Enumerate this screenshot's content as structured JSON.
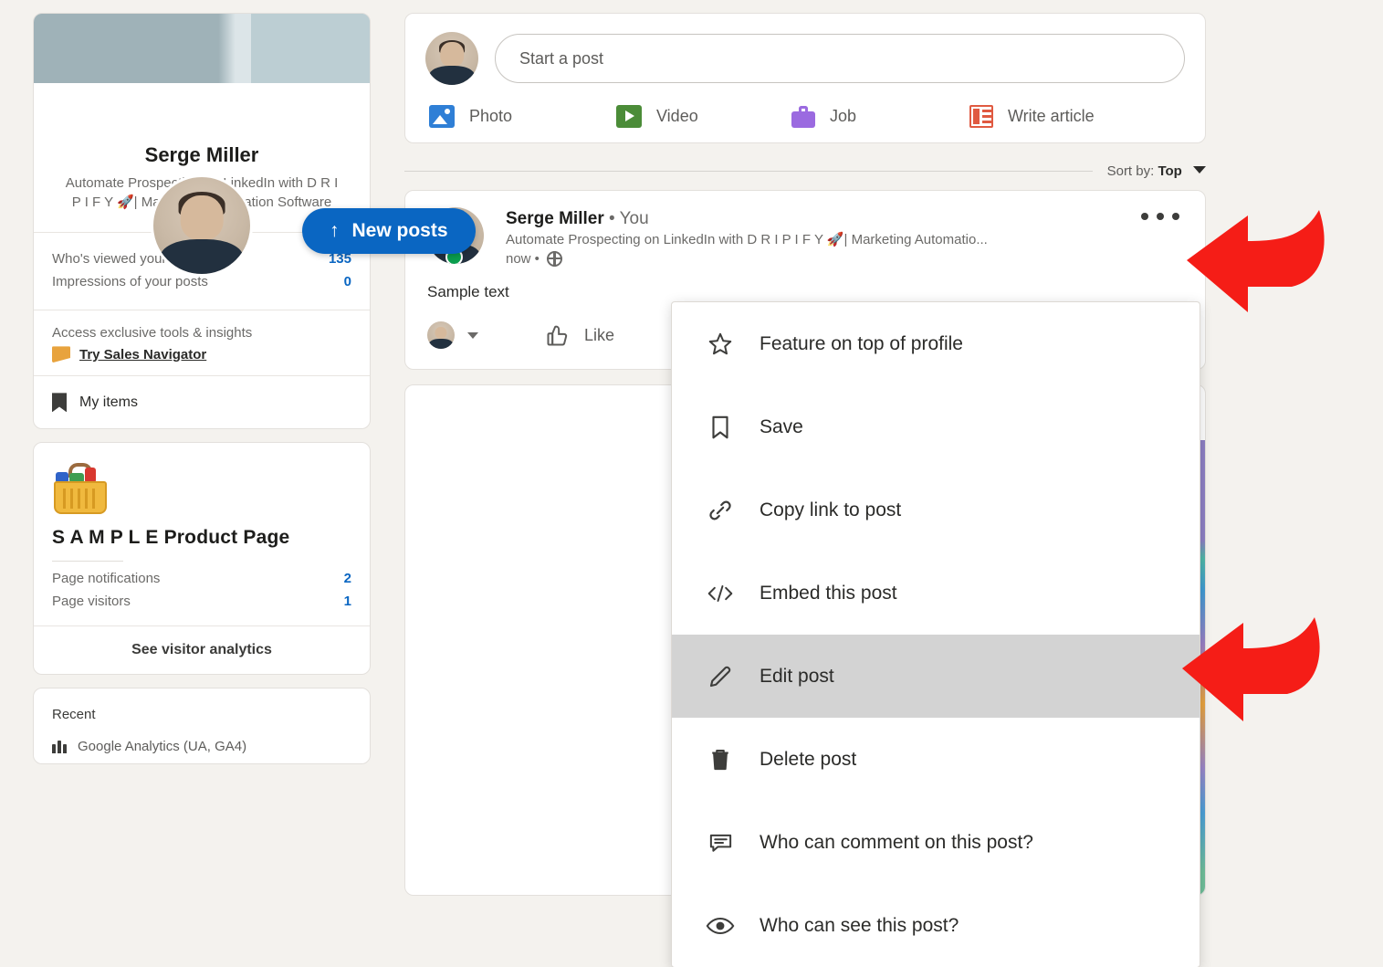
{
  "sidebar": {
    "profile": {
      "name": "Serge Miller",
      "headline": "Automate Prospecting on LinkedIn with D R I P I F Y 🚀| Marketing Automation Software",
      "avatar_icon": "user-avatar"
    },
    "stats": [
      {
        "label": "Who's viewed your profile",
        "value": "135"
      },
      {
        "label": "Impressions of your posts",
        "value": "0"
      }
    ],
    "tools": {
      "label": "Access exclusive tools & insights",
      "link": "Try Sales Navigator",
      "icon": "sales-navigator-icon"
    },
    "my_items": {
      "label": "My items",
      "icon": "bookmark-icon"
    },
    "product_page": {
      "icon": "shopping-basket-icon",
      "title": "S A M P L E Product Page",
      "stats": [
        {
          "label": "Page notifications",
          "value": "2"
        },
        {
          "label": "Page visitors",
          "value": "1"
        }
      ],
      "cta": "See visitor analytics"
    },
    "recent": {
      "title": "Recent",
      "items": [
        {
          "label": "Google Analytics (UA, GA4)",
          "icon": "group-icon"
        }
      ]
    }
  },
  "composer": {
    "placeholder": "Start a post",
    "actions": [
      {
        "label": "Photo",
        "icon": "photo-icon"
      },
      {
        "label": "Video",
        "icon": "video-icon"
      },
      {
        "label": "Job",
        "icon": "job-icon"
      },
      {
        "label": "Write article",
        "icon": "article-icon"
      }
    ]
  },
  "feed": {
    "sort_prefix": "Sort by:",
    "sort_value": "Top",
    "new_posts_label": "New posts",
    "new_posts_arrow": "↑",
    "post": {
      "author": "Serge Miller",
      "author_suffix": "• You",
      "headline": "Automate Prospecting on LinkedIn with D R I P I F Y 🚀| Marketing Automatio...",
      "time": "now •",
      "visibility_icon": "globe-icon",
      "body": "Sample text",
      "like_label": "Like",
      "overflow_icon": "more-options-icon"
    }
  },
  "dropdown": {
    "items": [
      {
        "label": "Feature on top of profile",
        "icon": "star-icon",
        "active": false
      },
      {
        "label": "Save",
        "icon": "bookmark-icon",
        "active": false
      },
      {
        "label": "Copy link to post",
        "icon": "link-icon",
        "active": false
      },
      {
        "label": "Embed this post",
        "icon": "code-icon",
        "active": false
      },
      {
        "label": "Edit post",
        "icon": "pencil-icon",
        "active": true
      },
      {
        "label": "Delete post",
        "icon": "trash-icon",
        "active": false
      },
      {
        "label": "Who can comment on this post?",
        "icon": "comment-icon",
        "active": false
      },
      {
        "label": "Who can see this post?",
        "icon": "eye-icon",
        "active": false
      }
    ]
  },
  "annotations": {
    "arrow_color": "#f51d17",
    "arrows": [
      {
        "name": "arrow-to-more-options"
      },
      {
        "name": "arrow-to-edit-post"
      }
    ]
  }
}
